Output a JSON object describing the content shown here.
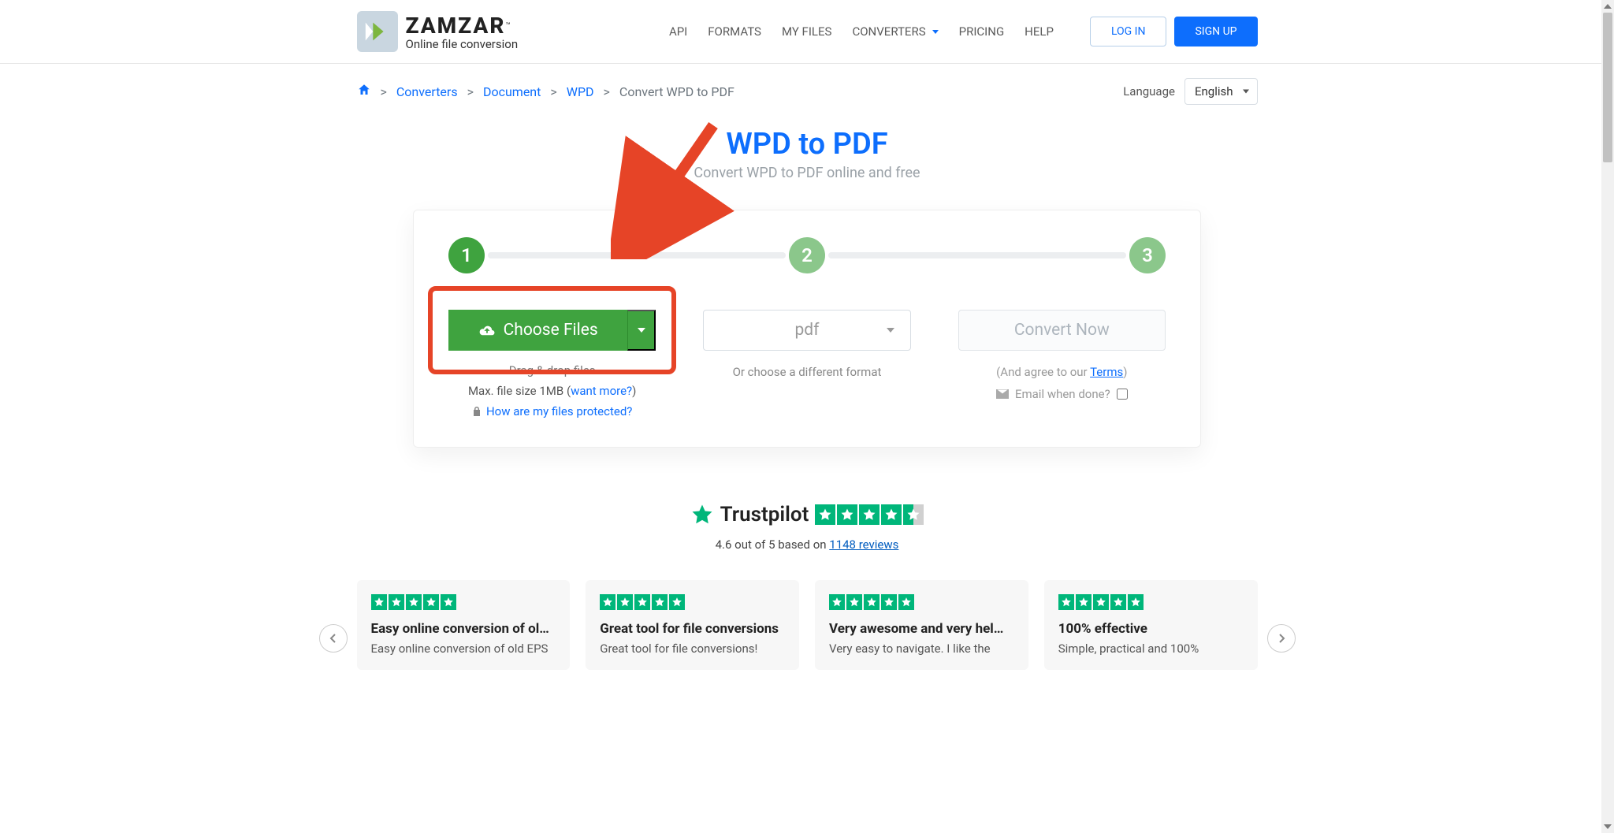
{
  "logo": {
    "title": "ZAMZAR",
    "tagline": "Online file conversion"
  },
  "nav": {
    "api": "API",
    "formats": "FORMATS",
    "myfiles": "MY FILES",
    "converters": "CONVERTERS",
    "pricing": "PRICING",
    "help": "HELP"
  },
  "auth": {
    "login": "LOG IN",
    "signup": "SIGN UP"
  },
  "breadcrumb": {
    "converters": "Converters",
    "document": "Document",
    "wpd": "WPD",
    "current": "Convert WPD to PDF"
  },
  "language": {
    "label": "Language",
    "selected": "English"
  },
  "hero": {
    "title": "WPD to PDF",
    "subtitle": "Convert WPD to PDF online and free"
  },
  "steps": {
    "n1": "1",
    "n2": "2",
    "n3": "3",
    "choose": "Choose Files",
    "drag": "Drag & drop files",
    "max_prefix": "Max. file size 1MB (",
    "want_more": "want more?",
    "max_suffix": ")",
    "protected": "How are my files protected?",
    "format": "pdf",
    "or_choose": "Or choose a different format",
    "convert": "Convert Now",
    "terms_prefix": "(And agree to our ",
    "terms_link": "Terms",
    "terms_suffix": ")",
    "email": "Email when done?"
  },
  "trust": {
    "name": "Trustpilot",
    "rating_text_prefix": "4.6 out of 5 based on ",
    "link": "1148 reviews"
  },
  "reviews": [
    {
      "title": "Easy online conversion of ol…",
      "body": "Easy online conversion of old EPS"
    },
    {
      "title": "Great tool for file conversions",
      "body": "Great tool for file conversions!"
    },
    {
      "title": "Very awesome and very hel…",
      "body": "Very easy to navigate. I like the"
    },
    {
      "title": "100% effective",
      "body": "Simple, practical and 100%"
    }
  ]
}
